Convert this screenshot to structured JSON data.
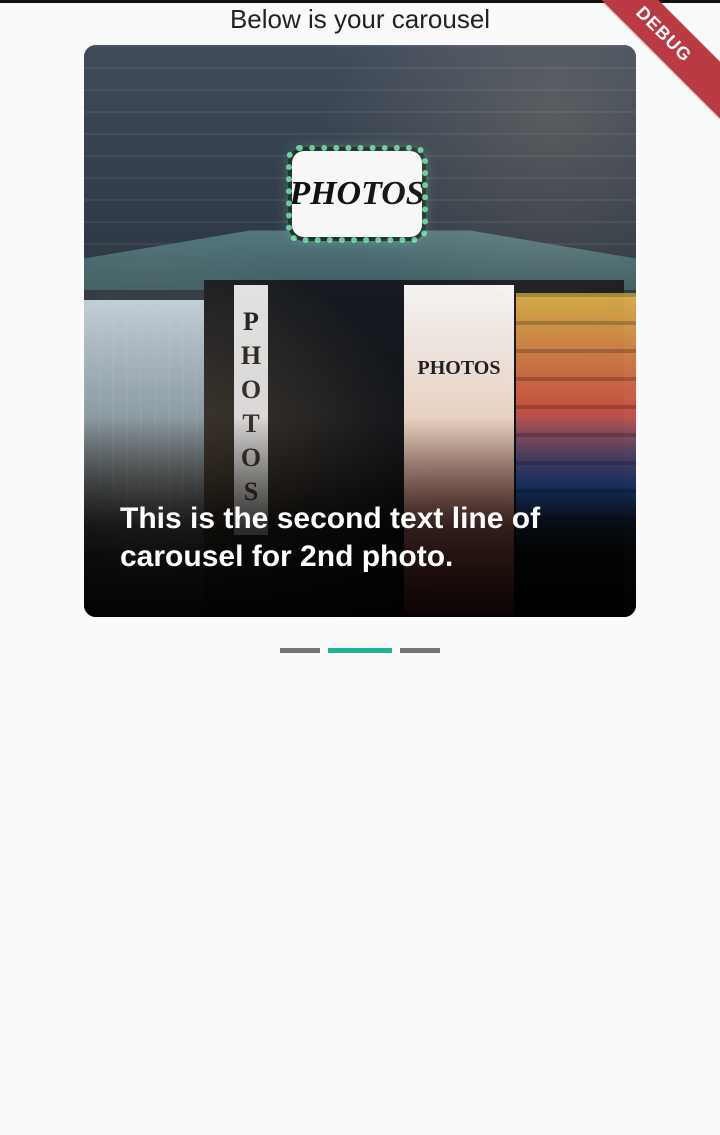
{
  "header": {
    "title": "Below is your carousel"
  },
  "carousel": {
    "caption": "This is the second text line of carousel for 2nd photo.",
    "image": {
      "sign_text": "PHOTOS",
      "vertical_text": "PHOTOS",
      "poster_text": "PHOTOS"
    },
    "indicators": [
      {
        "active": false,
        "color": "#757575"
      },
      {
        "active": true,
        "color": "#1ab394"
      },
      {
        "active": false,
        "color": "#757575"
      }
    ]
  },
  "debug_banner": {
    "label": "DEBUG",
    "color": "#b93a42"
  }
}
